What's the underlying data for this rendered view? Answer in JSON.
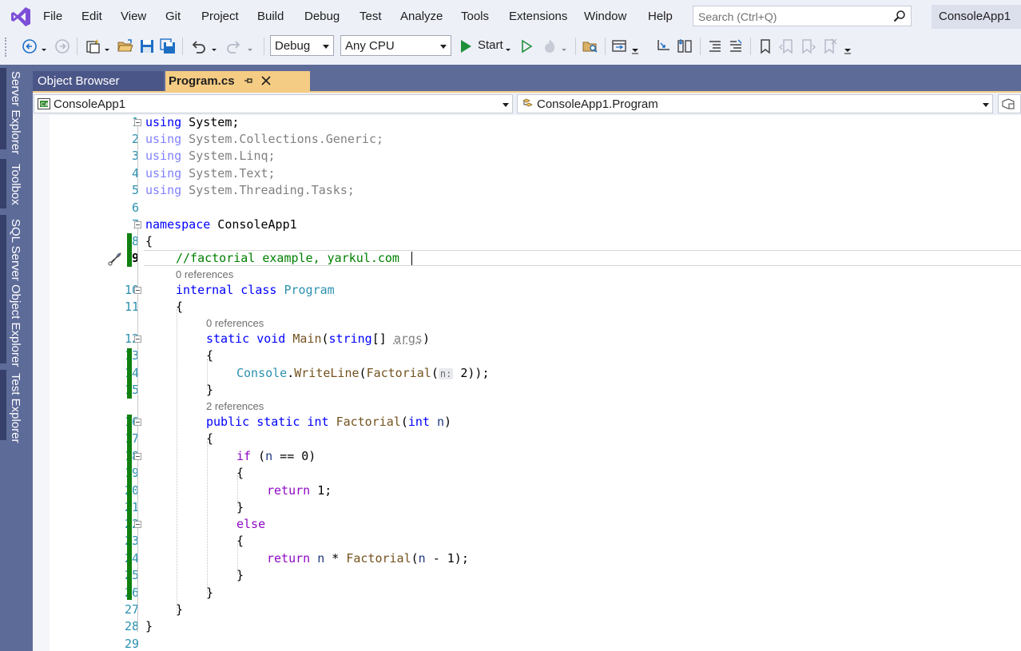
{
  "menu": {
    "items": [
      "File",
      "Edit",
      "View",
      "Git",
      "Project",
      "Build",
      "Debug",
      "Test",
      "Analyze",
      "Tools",
      "Extensions",
      "Window",
      "Help"
    ],
    "search_placeholder": "Search (Ctrl+Q)",
    "solution_name": "ConsoleApp1"
  },
  "toolbar": {
    "configuration": "Debug",
    "platform": "Any CPU",
    "start_label": "Start"
  },
  "left_dock": {
    "tabs": [
      "Server Explorer",
      "Toolbox",
      "SQL Server Object Explorer",
      "Test Explorer"
    ]
  },
  "tabs": {
    "object_browser": "Object Browser",
    "program": "Program.cs"
  },
  "navbar": {
    "project": "ConsoleApp1",
    "type": "ConsoleApp1.Program"
  },
  "editor": {
    "line_numbers": [
      "1",
      "2",
      "3",
      "4",
      "5",
      "6",
      "7",
      "8",
      "9",
      "10",
      "11",
      "12",
      "13",
      "14",
      "15",
      "16",
      "17",
      "18",
      "19",
      "20",
      "21",
      "22",
      "23",
      "24",
      "25",
      "26",
      "27",
      "28",
      "29"
    ],
    "current_line": "9",
    "refs": {
      "class_program": "0 references",
      "main": "0 references",
      "factorial": "2 references"
    },
    "code": {
      "l1_kw": "using",
      "l1_rest": " System;",
      "l2_kw": "using",
      "l2_rest": " System.Collections.Generic;",
      "l3_kw": "using",
      "l3_rest": " System.Linq;",
      "l4_kw": "using",
      "l4_rest": " System.Text;",
      "l5_kw": "using",
      "l5_rest": " System.Threading.Tasks;",
      "l7_kw": "namespace",
      "l7_rest": " ConsoleApp1",
      "l8": "{",
      "l9": "//factorial example, yarkul.com",
      "l10_kw": "internal class",
      "l10_type": "Program",
      "l11": "{",
      "l12_kw": "static void",
      "l12_meth": "Main",
      "l12_p1": "(",
      "l12_kw2": "string",
      "l12_p2": "[] ",
      "l12_param": "args",
      "l12_p3": ")",
      "l13": "{",
      "l14_type": "Console",
      "l14_dot": ".",
      "l14_meth": "WriteLine",
      "l14_p1": "(",
      "l14_meth2": "Factorial",
      "l14_p2": "(",
      "l14_hint": "n:",
      "l14_p3": " 2));",
      "l15": "}",
      "l16_kw": "public static int",
      "l16_meth": "Factorial",
      "l16_p1": "(",
      "l16_kw2": "int",
      "l16_param": " n",
      "l16_p2": ")",
      "l17": "{",
      "l18_kw": "if",
      "l18_p1": " (",
      "l18_param": "n",
      "l18_p2": " == 0)",
      "l19": "{",
      "l20_kw": "return",
      "l20_rest": " 1;",
      "l21": "}",
      "l22_kw": "else",
      "l23": "{",
      "l24_kw": "return",
      "l24_sp": " ",
      "l24_param": "n",
      "l24_p1": " * ",
      "l24_meth": "Factorial",
      "l24_p2": "(",
      "l24_param2": "n",
      "l24_p3": " - 1);",
      "l25": "}",
      "l26": "}",
      "l27": "}",
      "l28": "}"
    }
  },
  "colors": {
    "dock": "#5d6b99",
    "active_tab": "#f5cc84",
    "keyword": "#0000ff",
    "control_keyword": "#8f08c4",
    "type": "#2b91af",
    "method": "#74531f",
    "comment": "#008000",
    "change_bar": "#108010"
  }
}
